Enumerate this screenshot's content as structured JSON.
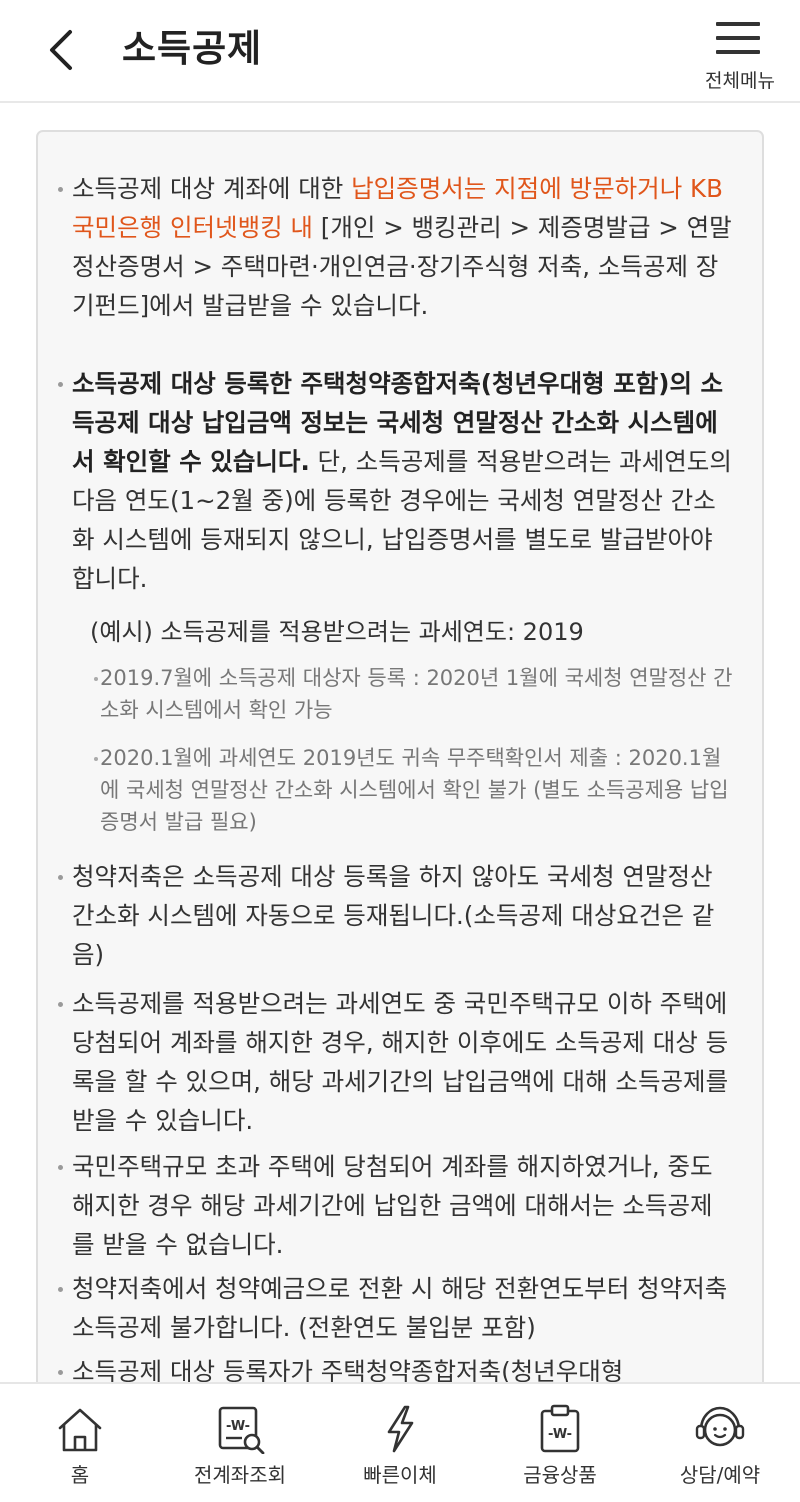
{
  "header": {
    "title": "소득공제",
    "back_icon": "chevron-left-icon",
    "menu_icon": "hamburger-icon",
    "menu_label": "전체메뉴"
  },
  "notice": {
    "item1": {
      "pre": "소득공제 대상 계좌에 대한 ",
      "accent": "납입증명서는 지점에 방문하거나 KB국민은행 인터넷뱅킹 내",
      "post": " [개인 > 뱅킹관리 > 제증명발급 > 연말정산증명서 > 주택마련·개인연금·장기주식형 저축, 소득공제 장기펀드]에서 발급받을 수 있습니다."
    },
    "item2": {
      "bold": "소득공제 대상 등록한 주택청약종합저축(청년우대형 포함)의 소득공제 대상 납입금액 정보는 국세청 연말정산 간소화 시스템에서 확인할 수 있습니다.",
      "post": " 단, 소득공제를 적용받으려는 과세연도의 다음 연도(1~2월 중)에 등록한 경우에는 국세청 연말정산 간소화 시스템에 등재되지 않으니, 납입증명서를 별도로 발급받아야 합니다."
    },
    "example_title": "(예시) 소득공제를 적용받으려는 과세연도: 2019",
    "example_items": [
      "2019.7월에 소득공제 대상자 등록 : 2020년 1월에 국세청 연말정산 간소화 시스템에서 확인 가능",
      "2020.1월에 과세연도 2019년도 귀속 무주택확인서 제출 : 2020.1월에 국세청 연말정산 간소화 시스템에서 확인 불가 (별도 소득공제용 납입증명서 발급 필요)"
    ],
    "item3": "청약저축은 소득공제 대상 등록을 하지 않아도 국세청 연말정산 간소화 시스템에 자동으로 등재됩니다.(소득공제 대상요건은 같음)",
    "item4": "소득공제를 적용받으려는 과세연도 중 국민주택규모 이하 주택에 당첨되어 계좌를 해지한 경우, 해지한 이후에도 소득공제 대상 등록을 할 수 있으며, 해당 과세기간의 납입금액에 대해 소득공제를 받을 수 있습니다.",
    "item5": "국민주택규모 초과 주택에 당첨되어 계좌를 해지하였거나, 중도해지한 경우 해당 과세기간에 납입한 금액에 대해서는 소득공제를 받을 수 없습니다.",
    "item6": "청약저축에서 청약예금으로 전환 시 해당 전환연도부터 청약저축 소득공제 불가합니다. (전환연도 불입분 포함)",
    "item7": "소득공제 대상 등록자가 주택청약종합저축(청년우대형"
  },
  "tabbar": {
    "tabs": [
      {
        "label": "홈",
        "icon": "home-icon"
      },
      {
        "label": "전계좌조회",
        "icon": "account-search-icon"
      },
      {
        "label": "빠른이체",
        "icon": "lightning-icon"
      },
      {
        "label": "금융상품",
        "icon": "product-document-icon"
      },
      {
        "label": "상담/예약",
        "icon": "consult-headset-icon"
      }
    ]
  },
  "colors": {
    "accent": "#e0561b",
    "box_bg": "#f7f7f7",
    "box_border": "#dedede",
    "text": "#333333",
    "sub_text": "#777777"
  }
}
